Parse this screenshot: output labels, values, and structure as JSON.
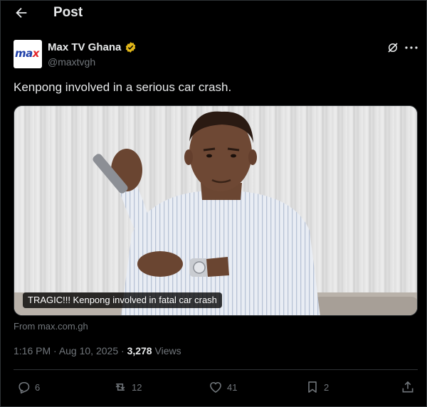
{
  "header": {
    "title": "Post"
  },
  "author": {
    "name": "Max TV Ghana",
    "handle": "@maxtvgh",
    "avatar_text_main": "ma",
    "avatar_text_accent": "x"
  },
  "post": {
    "text": "Kenpong involved in a serious car crash.",
    "media_caption": "TRAGIC!!! Kenpong involved in fatal car crash",
    "source": "From max.com.gh"
  },
  "meta": {
    "time": "1:16 PM",
    "separator1": " · ",
    "date": "Aug 10, 2025",
    "separator2": " · ",
    "views_count": "3,278",
    "views_label": " Views"
  },
  "actions": {
    "replies": "6",
    "reposts": "12",
    "likes": "41",
    "bookmarks": "2"
  },
  "icons": {
    "back": "arrow-left-icon",
    "verified": "verified-badge-icon",
    "grok": "grok-icon",
    "more": "more-icon",
    "reply": "reply-icon",
    "repost": "repost-icon",
    "like": "heart-icon",
    "bookmark": "bookmark-icon",
    "share": "share-icon"
  },
  "colors": {
    "background": "#000000",
    "text": "#e7e9ea",
    "muted": "#71767b",
    "verified": "#e2b719",
    "border": "#2f3336"
  }
}
